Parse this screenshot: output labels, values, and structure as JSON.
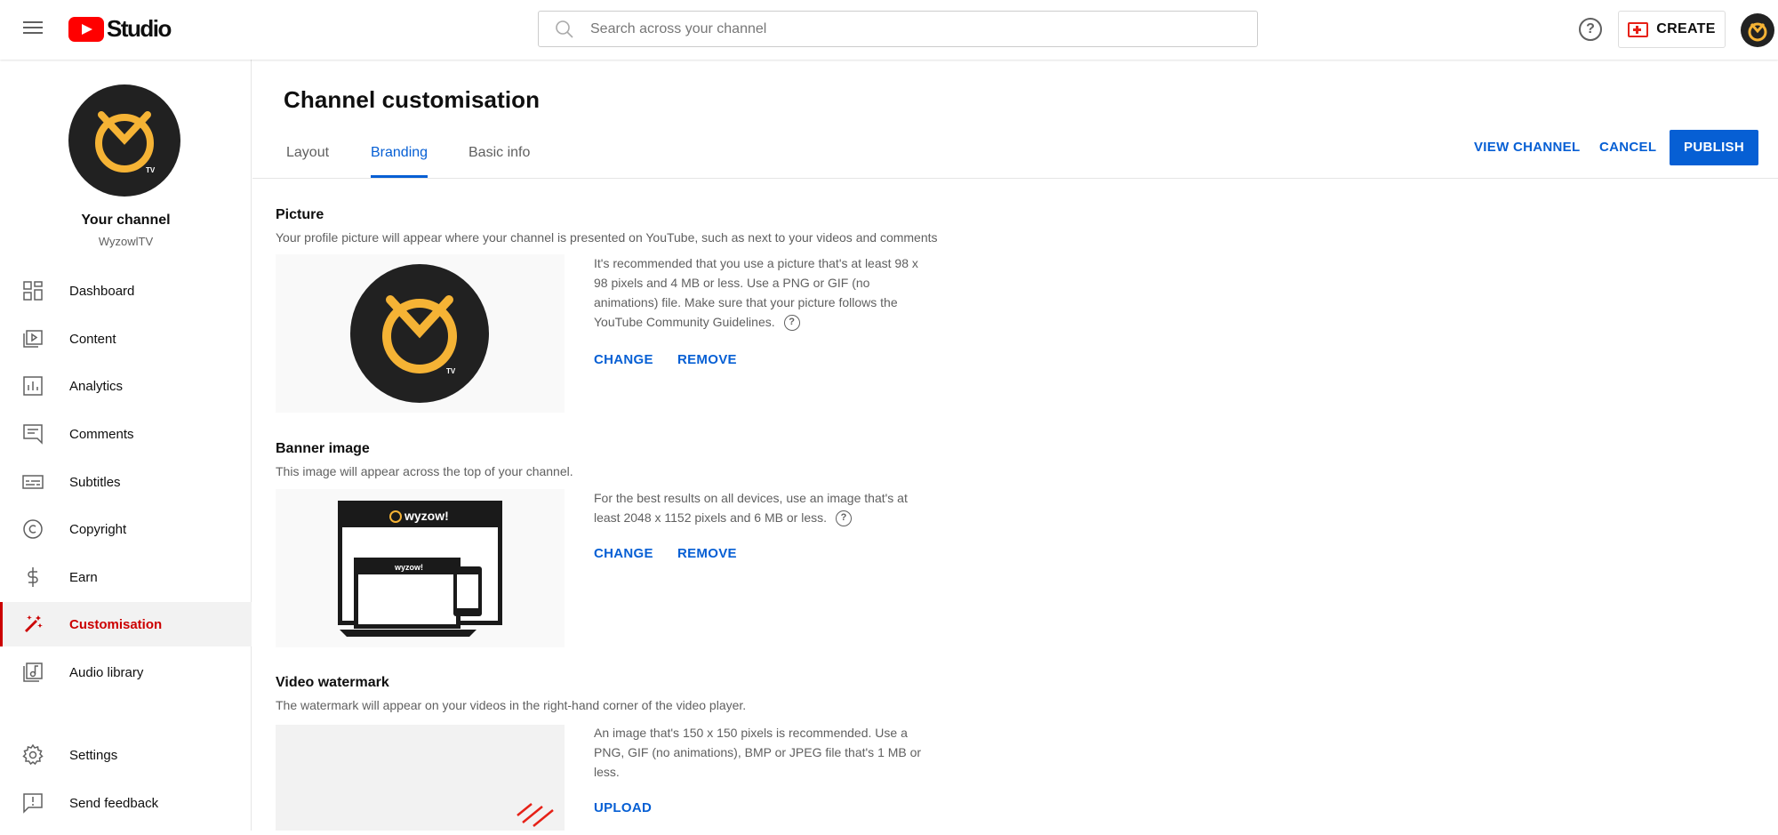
{
  "header": {
    "logo_text": "Studio",
    "search_placeholder": "Search across your channel",
    "create_label": "CREATE",
    "help_label": "?"
  },
  "sidebar": {
    "channel_title": "Your channel",
    "channel_handle": "WyzowlTV",
    "items": [
      {
        "label": "Dashboard",
        "icon": "dashboard-icon"
      },
      {
        "label": "Content",
        "icon": "content-icon"
      },
      {
        "label": "Analytics",
        "icon": "analytics-icon"
      },
      {
        "label": "Comments",
        "icon": "comments-icon"
      },
      {
        "label": "Subtitles",
        "icon": "subtitles-icon"
      },
      {
        "label": "Copyright",
        "icon": "copyright-icon"
      },
      {
        "label": "Earn",
        "icon": "earn-icon"
      },
      {
        "label": "Customisation",
        "icon": "customisation-icon",
        "active": true
      },
      {
        "label": "Audio library",
        "icon": "audio-library-icon"
      }
    ],
    "bottom_items": [
      {
        "label": "Settings",
        "icon": "settings-icon"
      },
      {
        "label": "Send feedback",
        "icon": "feedback-icon"
      }
    ]
  },
  "main": {
    "title": "Channel customisation",
    "tabs": [
      {
        "label": "Layout"
      },
      {
        "label": "Branding",
        "active": true
      },
      {
        "label": "Basic info"
      }
    ],
    "actions": {
      "view_channel": "VIEW CHANNEL",
      "cancel": "CANCEL",
      "publish": "PUBLISH"
    },
    "picture": {
      "title": "Picture",
      "description": "Your profile picture will appear where your channel is presented on YouTube, such as next to your videos and comments",
      "info": "It's recommended that you use a picture that's at least 98 x 98 pixels and 4 MB or less. Use a PNG or GIF (no animations) file. Make sure that your picture follows the YouTube Community Guidelines.",
      "change": "CHANGE",
      "remove": "REMOVE"
    },
    "banner": {
      "title": "Banner image",
      "description": "This image will appear across the top of your channel.",
      "info": "For the best results on all devices, use an image that's at least 2048 x 1152 pixels and 6 MB or less.",
      "change": "CHANGE",
      "remove": "REMOVE",
      "brand_text": "wyzow!"
    },
    "watermark": {
      "title": "Video watermark",
      "description": "The watermark will appear on your videos in the right-hand corner of the video player.",
      "info": "An image that's 150 x 150 pixels is recommended. Use a PNG, GIF (no animations), BMP or JPEG file that's 1 MB or less.",
      "upload": "UPLOAD"
    },
    "logo_badge": "TV"
  },
  "colors": {
    "accent_blue": "#065fd4",
    "active_red": "#cc0000",
    "logo_gold": "#f5b335",
    "logo_dark": "#212121"
  }
}
